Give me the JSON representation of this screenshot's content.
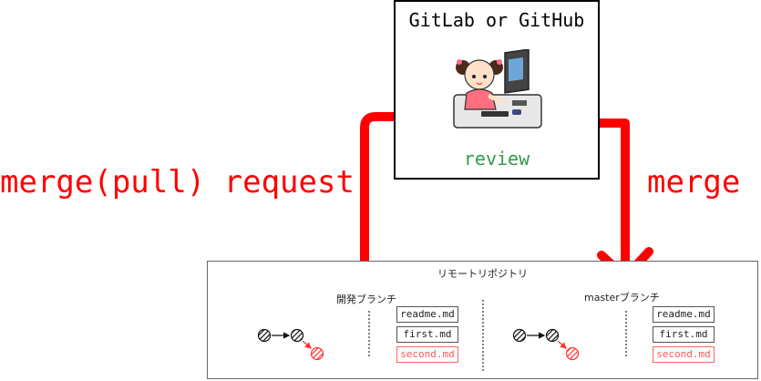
{
  "review_box": {
    "title": "GitLab or GitHub",
    "action_label": "review"
  },
  "arrows": {
    "left_label": "merge(pull) request",
    "right_label": "merge"
  },
  "remote_repository": {
    "title": "リモートリポジトリ",
    "branches": [
      {
        "label": "開発ブランチ",
        "files": [
          "readme.md",
          "first.md",
          "second.md"
        ]
      },
      {
        "label": "masterブランチ",
        "files": [
          "readme.md",
          "first.md",
          "second.md"
        ]
      }
    ]
  },
  "colors": {
    "arrow": "#ff0000",
    "review_text": "#2f9a4a",
    "new_commit": "#ff3333",
    "new_file": "#ff5555"
  }
}
